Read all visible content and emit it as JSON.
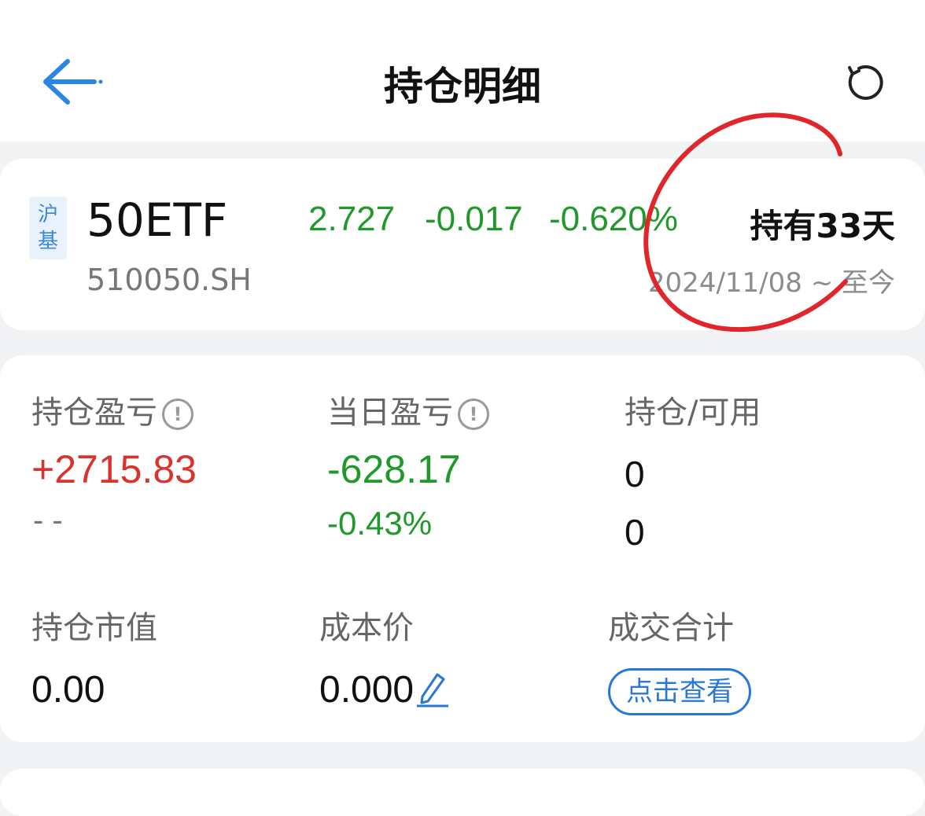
{
  "header": {
    "title": "持仓明细",
    "back_icon": "arrow-left-icon",
    "refresh_icon": "refresh-icon"
  },
  "stock": {
    "exchange": [
      "沪",
      "基"
    ],
    "name": "50ETF",
    "code": "510050.SH",
    "price": "2.727",
    "change": "-0.017",
    "change_pct": "-0.620%",
    "hold_days": "持有33天",
    "date_range": "2024/11/08 ~ 至今"
  },
  "stats": {
    "position_pnl": {
      "label": "持仓盈亏",
      "value": "+2715.83",
      "sub": "- -"
    },
    "daily_pnl": {
      "label": "当日盈亏",
      "value": "-628.17",
      "sub": "-0.43%"
    },
    "position_available": {
      "label": "持仓/可用",
      "position": "0",
      "available": "0"
    },
    "market_value": {
      "label": "持仓市值",
      "value": "0.00"
    },
    "cost_price": {
      "label": "成本价",
      "value": "0.000"
    },
    "trade_total": {
      "label": "成交合计",
      "button": "点击查看"
    }
  },
  "colors": {
    "up": "#d9342b",
    "down": "#1f9a2a",
    "accent": "#2a78d6",
    "annotation": "#e0262b"
  }
}
